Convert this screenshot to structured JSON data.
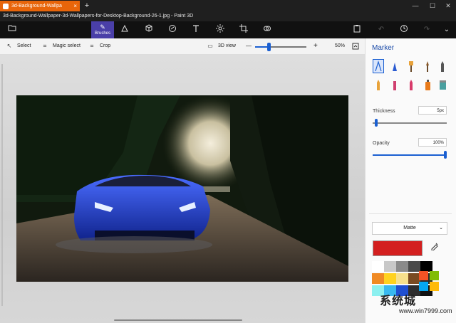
{
  "window": {
    "tab_title": "3d-Background-Wallpa",
    "tab_close": "×",
    "new_tab": "+",
    "doc_title": "3d-Background-Wallpaper-3d-Wallpapers-for-Desktop-Background-26-1.jpg - Paint 3D",
    "controls": {
      "minimize": "—",
      "maximize": "☐",
      "close": "✕"
    }
  },
  "toolbar": {
    "active_tool_label": "Brushes"
  },
  "commandbar": {
    "select_label": "Select",
    "magic_select_label": "Magic select",
    "crop_label": "Crop",
    "view_3d_label": "3D view",
    "zoom_minus": "—",
    "zoom_plus": "+",
    "zoom_level": "50%",
    "zoom_fraction": 0.27
  },
  "panel": {
    "title": "Marker",
    "thickness_label": "Thickness",
    "thickness_value": "5px",
    "thickness_fraction": 0.05,
    "opacity_label": "Opacity",
    "opacity_value": "100%",
    "opacity_fraction": 1.0,
    "finish_label": "Matte",
    "finish_chevron": "⌄",
    "current_color": "#d31f1f",
    "palette": [
      [
        "#ffffff",
        "#c8c8c8",
        "#8a8a8a",
        "#4a4a4a",
        "#000000"
      ],
      [
        "#f08a24",
        "#ffd21f",
        "#f7e08c",
        "#7a4b22",
        "#2b2b2b"
      ],
      [
        "#8cf0f0",
        "#39b9f0",
        "#1f4fd1",
        "#2e2e2e",
        "#111111"
      ]
    ]
  },
  "watermark": {
    "text": "系统城",
    "url": "www.win7999.com"
  },
  "colors": {
    "accent": "#4a3fa8",
    "slider": "#1a5fd1",
    "tab_orange": "#e8650a"
  }
}
